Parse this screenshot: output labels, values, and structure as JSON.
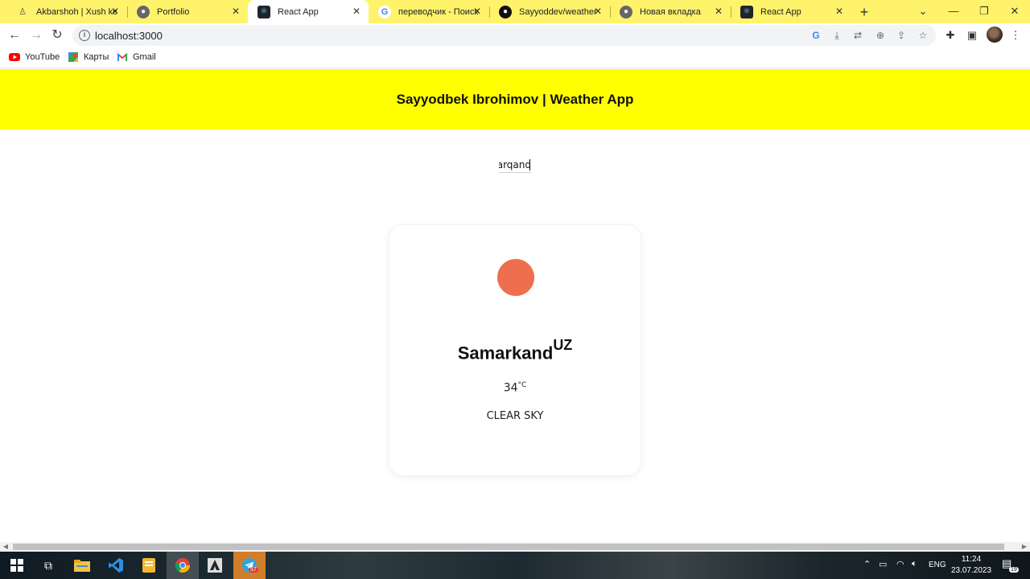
{
  "browser": {
    "tabs": [
      {
        "title": "Akbarshoh | Xush kelib"
      },
      {
        "title": "Portfolio"
      },
      {
        "title": "React App"
      },
      {
        "title": "переводчик - Поиск"
      },
      {
        "title": "Sayyoddev/weather"
      },
      {
        "title": "Новая вкладка"
      },
      {
        "title": "React App"
      }
    ],
    "url": "localhost:3000",
    "bookmarks": [
      {
        "label": "YouTube"
      },
      {
        "label": "Карты"
      },
      {
        "label": "Gmail"
      }
    ]
  },
  "app": {
    "header_title": "Sayyodbek Ibrohimov | Weather App",
    "search_value": "arqand",
    "card": {
      "city": "Samarkand",
      "country": "UZ",
      "temperature": "34",
      "unit": "°C",
      "description": "CLEAR SKY"
    }
  },
  "taskbar": {
    "language": "ENG",
    "time": "11:24",
    "date": "23.07.2023",
    "telegram_badge": "57",
    "notification_count": "19"
  }
}
